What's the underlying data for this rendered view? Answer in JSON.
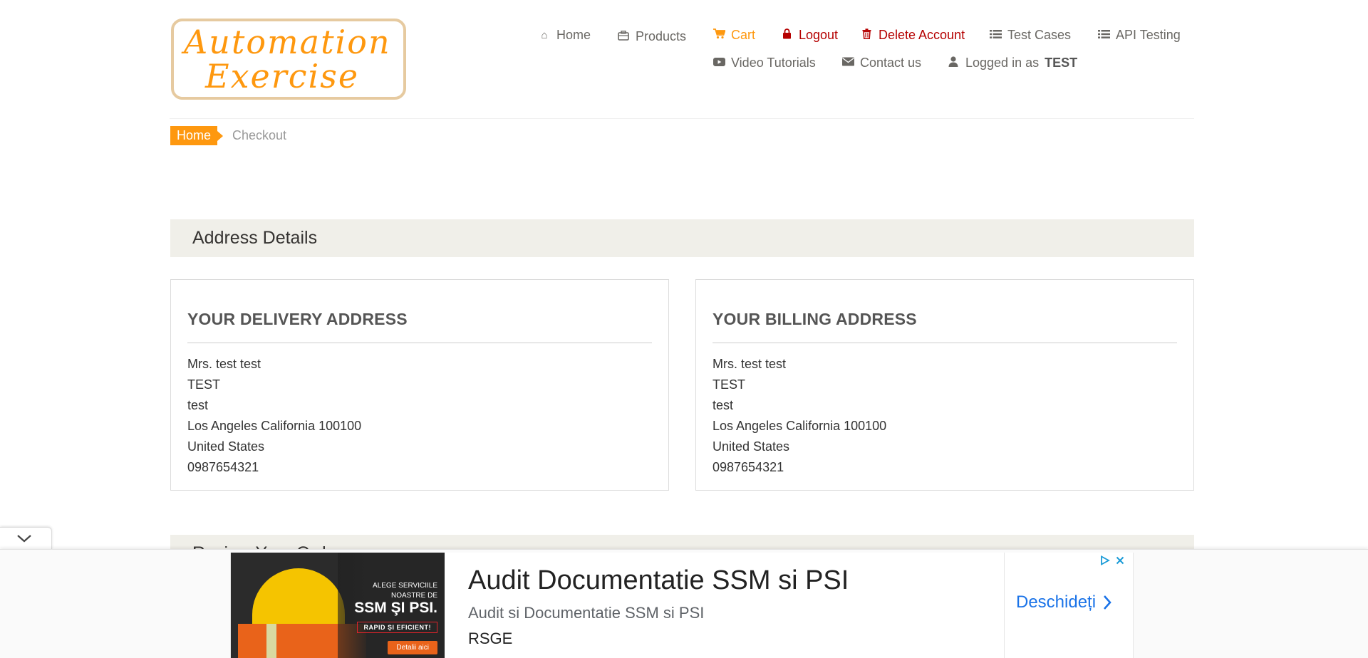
{
  "logo": {
    "line1": "Automation",
    "line2": "Exercise"
  },
  "nav": {
    "home": "Home",
    "products": "Products",
    "cart": "Cart",
    "logout": "Logout",
    "delete_account": "Delete Account",
    "test_cases": "Test Cases",
    "api_testing": "API Testing",
    "video_tutorials": "Video Tutorials",
    "contact_us": "Contact us",
    "logged_in_prefix": "Logged in as",
    "logged_in_user": "TEST"
  },
  "breadcrumb": {
    "home": "Home",
    "current": "Checkout"
  },
  "address_details": {
    "heading": "Address Details",
    "delivery": {
      "title": "YOUR DELIVERY ADDRESS",
      "name": "Mrs. test test",
      "company": "TEST",
      "address1": "test",
      "city_state_zip": "Los Angeles California 100100",
      "country": "United States",
      "phone": "0987654321"
    },
    "billing": {
      "title": "YOUR BILLING ADDRESS",
      "name": "Mrs. test test",
      "company": "TEST",
      "address1": "test",
      "city_state_zip": "Los Angeles California 100100",
      "country": "United States",
      "phone": "0987654321"
    }
  },
  "review_section": {
    "heading": "Review Your Order"
  },
  "ad": {
    "image_text_1": "ALEGE SERVICIILE NOASTRE DE",
    "image_text_2": "SSM ŞI PSI.",
    "image_text_3": "RAPID ȘI EFICIENT!",
    "image_button": "Detalii aici",
    "title": "Audit Documentatie SSM si PSI",
    "subtitle": "Audit si Documentatie SSM si PSI",
    "brand": "RSGE",
    "cta": "Deschideți"
  },
  "colors": {
    "accent": "#FE980F",
    "danger": "#B50000",
    "section_bg": "#F0EFE9",
    "ad_link": "#1A73E8"
  }
}
